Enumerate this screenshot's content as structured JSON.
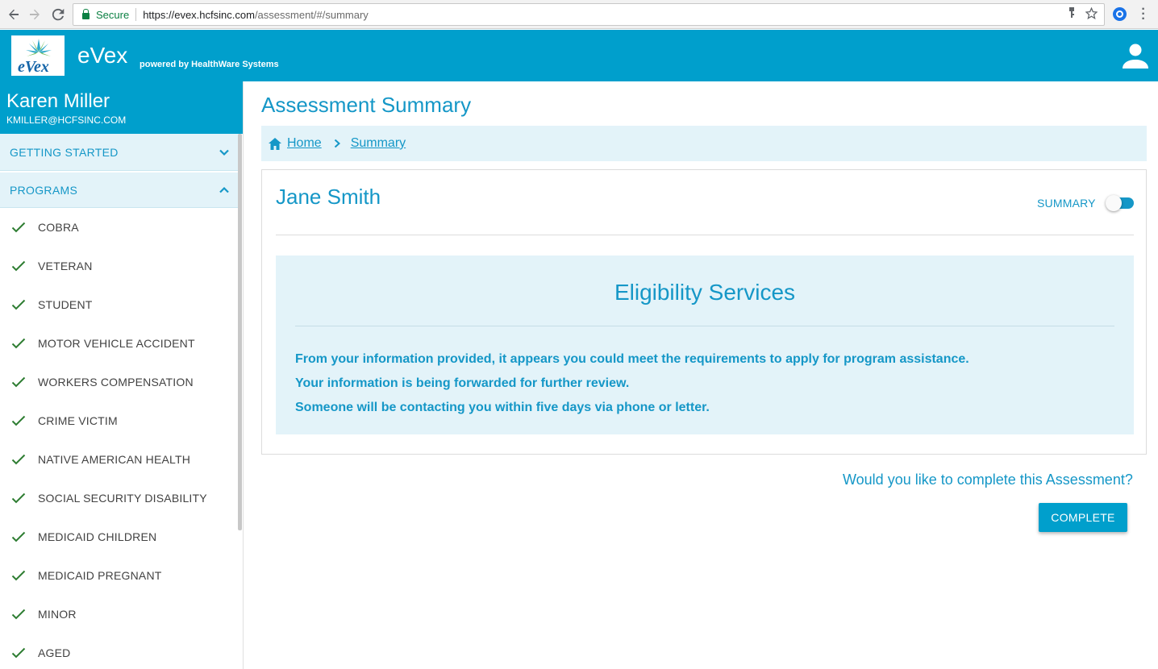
{
  "browser": {
    "secure_label": "Secure",
    "url_host": "https://evex.hcfsinc.com",
    "url_path": "/assessment/#/summary"
  },
  "header": {
    "logo_text": "eVex",
    "brand": "eVex",
    "powered_by": "powered by HealthWare Systems"
  },
  "sidebar": {
    "user_name": "Karen Miller",
    "user_email": "KMILLER@HCFSINC.COM",
    "getting_started": "GETTING STARTED",
    "programs": "PROGRAMS",
    "program_items": [
      "COBRA",
      "VETERAN",
      "STUDENT",
      "MOTOR VEHICLE ACCIDENT",
      "WORKERS COMPENSATION",
      "CRIME VICTIM",
      "NATIVE AMERICAN HEALTH",
      "SOCIAL SECURITY DISABILITY",
      "MEDICAID CHILDREN",
      "MEDICAID PREGNANT",
      "MINOR",
      "AGED"
    ]
  },
  "main": {
    "page_title": "Assessment Summary",
    "breadcrumb": {
      "home": "Home",
      "current": "Summary"
    },
    "card": {
      "patient_name": "Jane Smith",
      "summary_label": "SUMMARY",
      "summary_toggle_on": true,
      "panel_title": "Eligibility Services",
      "lines": [
        "From your information provided, it appears you could meet the requirements to apply for program assistance.",
        "Your information is being forwarded for further review.",
        "Someone will be contacting you within five days via phone or letter."
      ]
    },
    "complete_question": "Would you like to complete this Assessment?",
    "complete_button": "COMPLETE"
  },
  "colors": {
    "brand_blue": "#009fcc",
    "text_blue": "#1597c7",
    "light_panel": "#e3f3f9",
    "check_green": "#2e7d32"
  }
}
